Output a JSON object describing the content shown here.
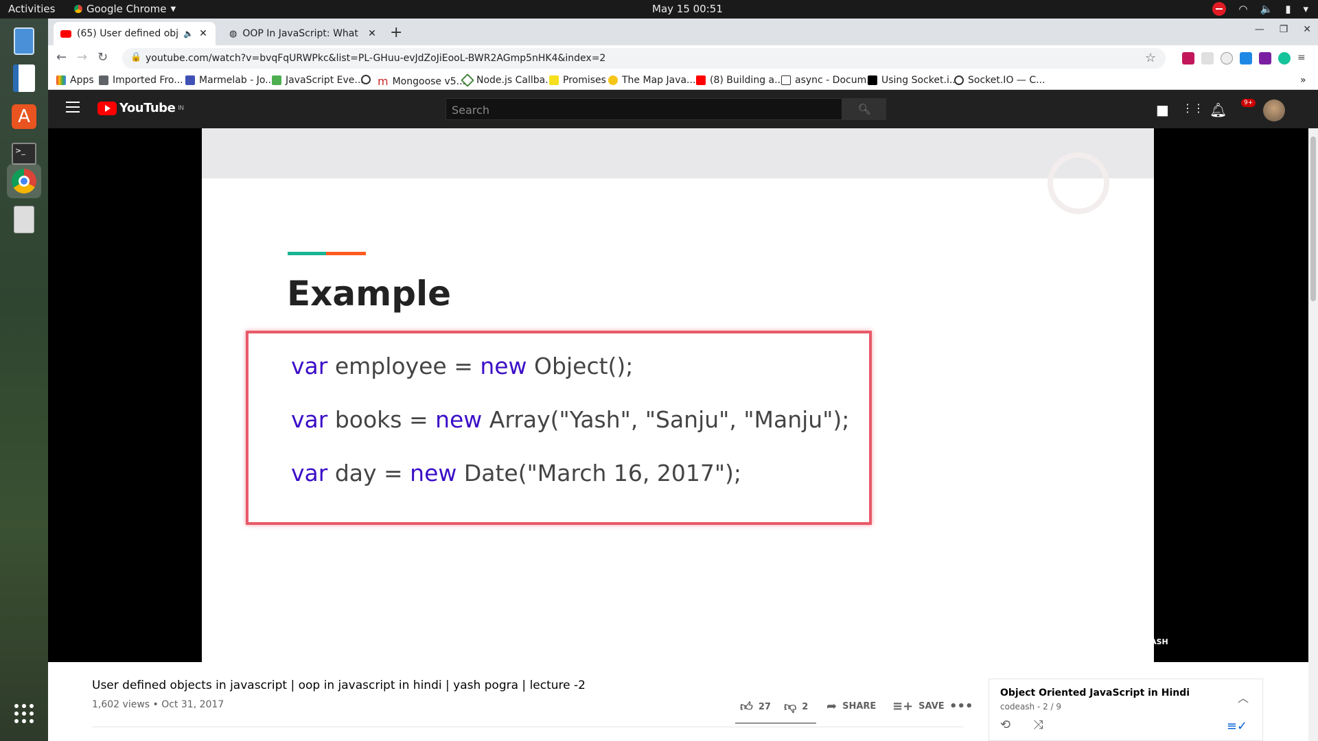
{
  "topbar": {
    "activities": "Activities",
    "app_name": "Google Chrome",
    "clock": "May 15  00:51"
  },
  "chrome": {
    "tabs": [
      {
        "title": "(65) User defined obje",
        "favicon": "youtube-icon"
      },
      {
        "title": "OOP In JavaScript: What",
        "favicon": "globe-icon"
      }
    ],
    "url": "youtube.com/watch?v=bvqFqURWPkc&list=PL-GHuu-evJdZoJiEooL-BWR2AGmp5nHK4&index=2",
    "bookmarks": [
      "Apps",
      "Imported Fro...",
      "Marmelab - Jo...",
      "JavaScript Eve...",
      "Mongoose v5....",
      "Node.js Callba...",
      "Promises",
      "The Map Java...",
      "(8) Building a...",
      "async - Docum...",
      "Using Socket.i...",
      "Socket.IO — C..."
    ],
    "more": "»"
  },
  "youtube": {
    "logo": "YouTube",
    "logo_region": "IN",
    "search_placeholder": "Search",
    "notification_badge": "9+",
    "slide": {
      "heading": "Example",
      "code_lines": [
        {
          "kw1": "var",
          "mid": " employee = ",
          "kw2": "new",
          "rest": " Object();"
        },
        {
          "kw1": "var",
          "mid": " books = ",
          "kw2": "new",
          "rest": " Array(\"Yash\", \"Sanju\", \"Manju\");"
        },
        {
          "kw1": "var",
          "mid": " day = ",
          "kw2": "new",
          "rest": " Date(\"March 16, 2017\");"
        }
      ],
      "watermark": "CODEASH"
    },
    "video": {
      "title": "User defined objects in javascript | oop in javascript in hindi | yash pogra | lecture -2",
      "meta": "1,602 views • Oct 31, 2017",
      "likes": "27",
      "dislikes": "2",
      "share": "SHARE",
      "save": "SAVE"
    },
    "playlist": {
      "title": "Object Oriented JavaScript in Hindi",
      "sub": "codeash - 2 / 9"
    }
  }
}
